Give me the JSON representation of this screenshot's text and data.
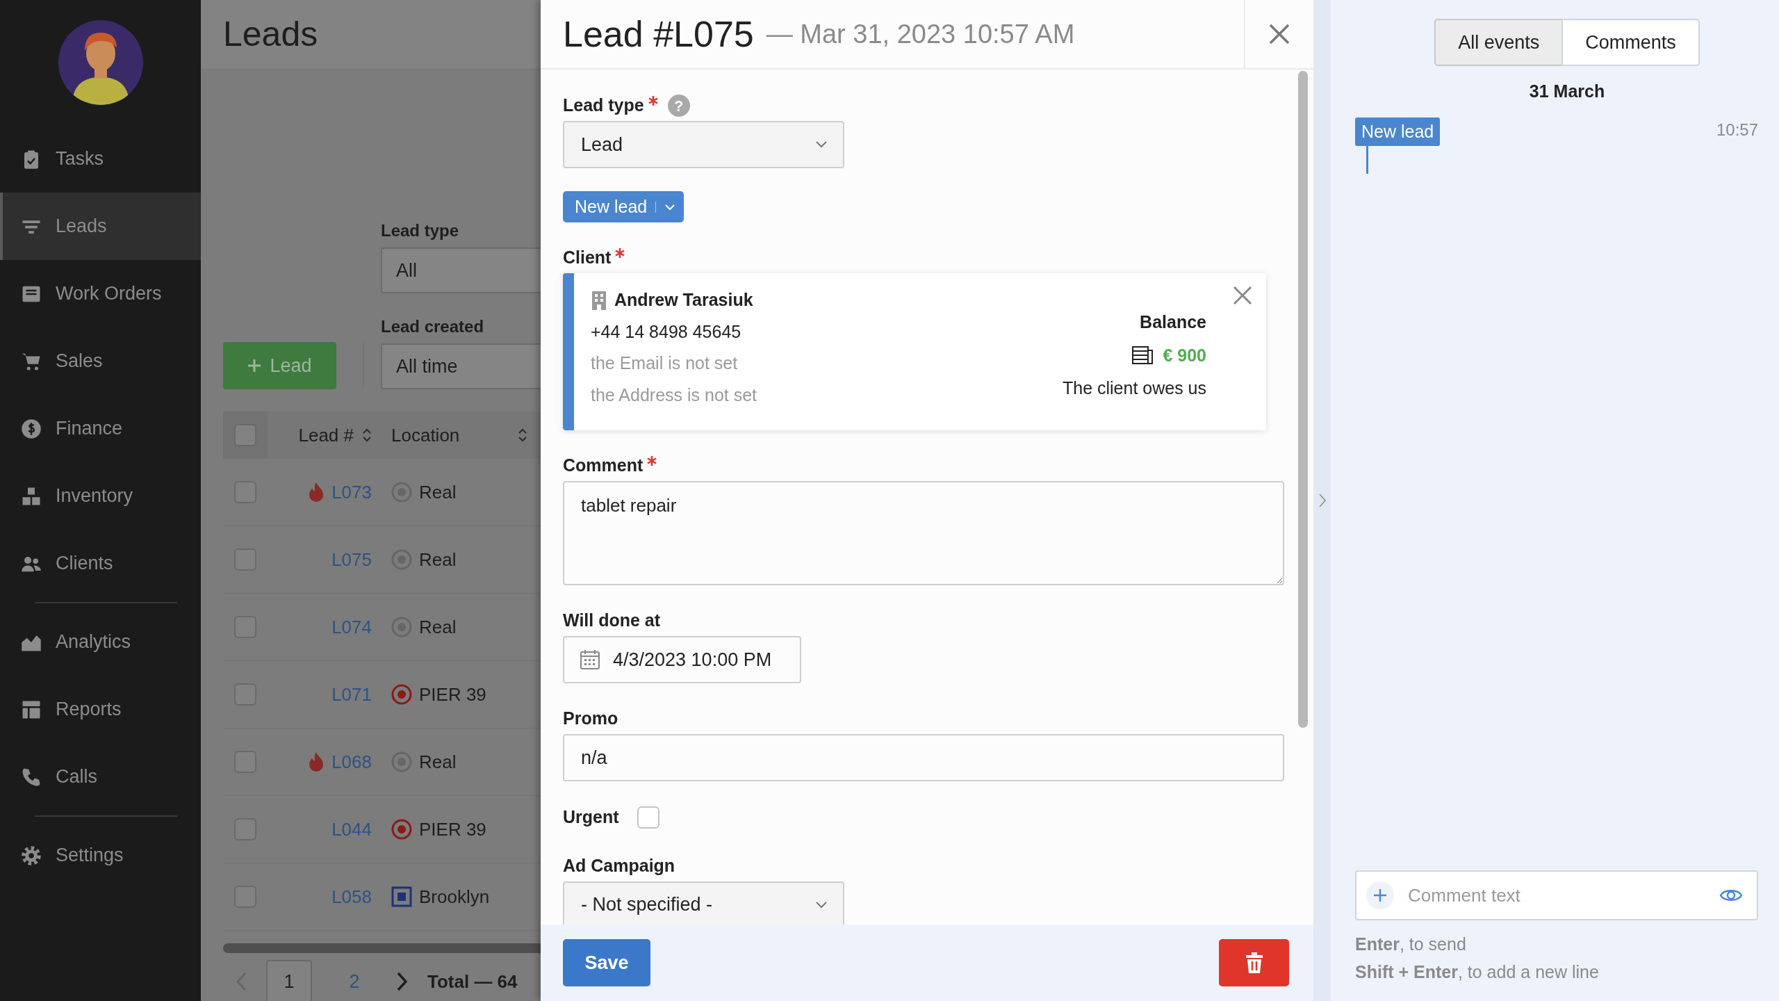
{
  "sidebar": {
    "groups": [
      [
        {
          "label": "Tasks",
          "selected": false
        },
        {
          "label": "Leads",
          "selected": true
        },
        {
          "label": "Work Orders",
          "selected": false
        },
        {
          "label": "Sales",
          "selected": false
        },
        {
          "label": "Finance",
          "selected": false
        },
        {
          "label": "Inventory",
          "selected": false
        },
        {
          "label": "Clients",
          "selected": false
        }
      ],
      [
        {
          "label": "Analytics",
          "selected": false
        },
        {
          "label": "Reports",
          "selected": false
        },
        {
          "label": "Calls",
          "selected": false
        }
      ],
      [
        {
          "label": "Settings",
          "selected": false
        }
      ]
    ]
  },
  "leads_page": {
    "title": "Leads",
    "add_button": "Lead",
    "filters": [
      {
        "label": "Lead type",
        "value": "All"
      },
      {
        "label": "Lead created",
        "value": "All time"
      }
    ],
    "table": {
      "header_checked": false,
      "columns": [
        "Lead #",
        "Location"
      ],
      "rows": [
        {
          "checked": false,
          "hot": true,
          "lead": "L073",
          "location": "Real",
          "kind": "dot"
        },
        {
          "checked": false,
          "hot": false,
          "lead": "L075",
          "location": "Real",
          "kind": "dot"
        },
        {
          "checked": false,
          "hot": false,
          "lead": "L074",
          "location": "Real",
          "kind": "dot"
        },
        {
          "checked": false,
          "hot": false,
          "lead": "L071",
          "location": "PIER 39",
          "kind": "target"
        },
        {
          "checked": false,
          "hot": true,
          "lead": "L068",
          "location": "Real",
          "kind": "dot"
        },
        {
          "checked": false,
          "hot": false,
          "lead": "L044",
          "location": "PIER 39",
          "kind": "target"
        },
        {
          "checked": false,
          "hot": false,
          "lead": "L058",
          "location": "Brooklyn",
          "kind": "square"
        }
      ]
    },
    "pagination": {
      "pages": [
        {
          "label": "1",
          "selected": true
        },
        {
          "label": "2",
          "selected": false
        }
      ],
      "total": "Total — 64"
    }
  },
  "lead_modal": {
    "title": "Lead #L075",
    "subtitle": "— Mar 31, 2023 10:57 AM",
    "fields": [
      {
        "kind": "select",
        "label": "Lead type",
        "required": true,
        "help": "?",
        "value": "Lead"
      },
      {
        "kind": "status",
        "value": "New lead"
      },
      {
        "kind": "client",
        "label": "Client",
        "required": true,
        "name": "Andrew Tarasiuk",
        "phone": "+44 14 8498 45645",
        "email": "the Email is not set",
        "address": "the Address is not set",
        "balance_label": "Balance",
        "balance": "€ 900",
        "balance_note": "The client owes us"
      },
      {
        "kind": "textarea",
        "label": "Comment",
        "required": true,
        "value": "tablet repair"
      },
      {
        "kind": "date",
        "label": "Will done at",
        "required": false,
        "value": "4/3/2023 10:00 PM"
      },
      {
        "kind": "text",
        "label": "Promo",
        "required": false,
        "value": "n/a"
      },
      {
        "kind": "checkbox",
        "label": "Urgent",
        "checked": false
      },
      {
        "kind": "select",
        "label": "Ad Campaign",
        "required": false,
        "value": "- Not specified -"
      }
    ],
    "save_button": "Save"
  },
  "activity": {
    "tabs": [
      {
        "label": "All events",
        "selected": true
      },
      {
        "label": "Comments",
        "selected": false
      }
    ],
    "date": "31 March",
    "events": [
      {
        "label": "New lead",
        "time": "10:57"
      }
    ],
    "comment": {
      "placeholder": "Comment text"
    },
    "hints": [
      "**Enter**, to send",
      "**Shift + Enter**, to add a new line"
    ]
  }
}
